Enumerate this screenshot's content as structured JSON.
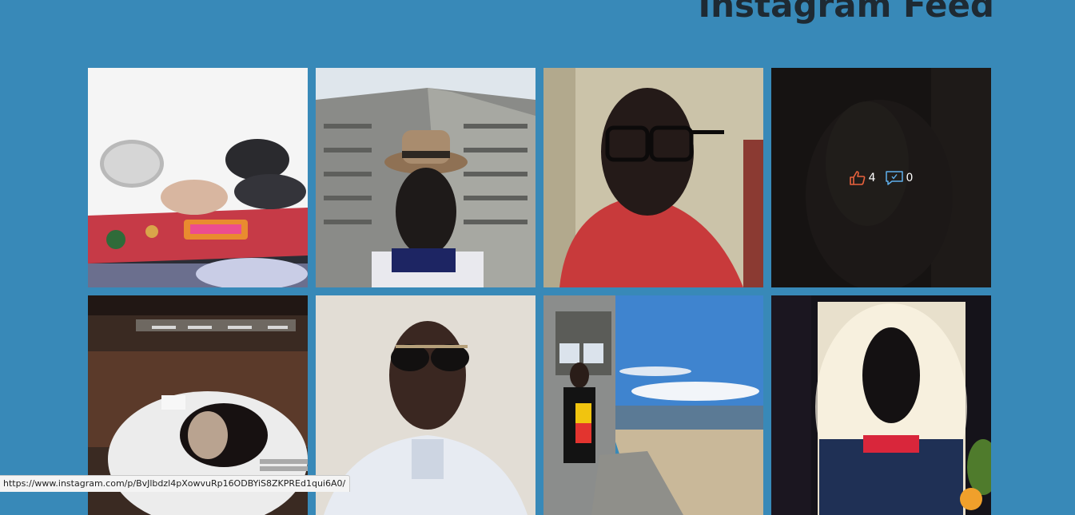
{
  "page": {
    "title": "Instagram Feed"
  },
  "feed": {
    "items": [
      {
        "image": "dunkin-donuts-box-photo"
      },
      {
        "image": "man-in-hat-tower-selfie-photo"
      },
      {
        "image": "man-with-glasses-red-shirt-photo"
      },
      {
        "image": "dark-selfie-photo",
        "likes": "4",
        "comments": "0"
      },
      {
        "image": "chocolate-cake-plate-photo"
      },
      {
        "image": "man-with-sunglasses-white-shirt-photo"
      },
      {
        "image": "man-by-beach-photo"
      },
      {
        "image": "backlit-portrait-photo"
      }
    ]
  },
  "status_bar": {
    "url": "https://www.instagram.com/p/BvJlbdzl4pXowvuRp16ODBYiS8ZKPREd1qui6A0/"
  },
  "colors": {
    "background": "#3889b8",
    "title": "#1e2a33",
    "like_icon": "#e8613c",
    "comment_icon": "#5fb0ec"
  }
}
